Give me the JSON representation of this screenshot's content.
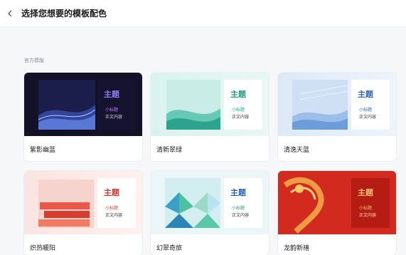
{
  "header": {
    "title": "选择您想要的模板配色"
  },
  "section": {
    "label": "官方模版"
  },
  "cards": [
    {
      "name": "紫影幽蓝",
      "heading": "主题",
      "subheading": "小标题",
      "body": "正文内容",
      "accent": "#8f7df5",
      "subcolor": "#c07cff"
    },
    {
      "name": "清新翠绿",
      "heading": "主题",
      "subheading": "小标题",
      "body": "正文内容",
      "accent": "#1e9a83",
      "subcolor": "#15a88c"
    },
    {
      "name": "清逸天蓝",
      "heading": "主题",
      "subheading": "小标题",
      "body": "正文内容",
      "accent": "#2f64b7",
      "subcolor": "#2f64b7"
    },
    {
      "name": "炽热暖阳",
      "heading": "主题",
      "subheading": "小标题",
      "body": "正文内容",
      "accent": "#cf3a2e",
      "subcolor": "#cf3a2e"
    },
    {
      "name": "幻翠奇旅",
      "heading": "主题",
      "subheading": "小标题",
      "body": "正文内容",
      "accent": "#2b5fb5",
      "subcolor": "#1d9b78"
    },
    {
      "name": "龙韵新禧",
      "heading": "主题",
      "subheading": "小标题",
      "body": "正文内容",
      "accent": "#f3c36a",
      "subcolor": "#f3c36a"
    }
  ]
}
